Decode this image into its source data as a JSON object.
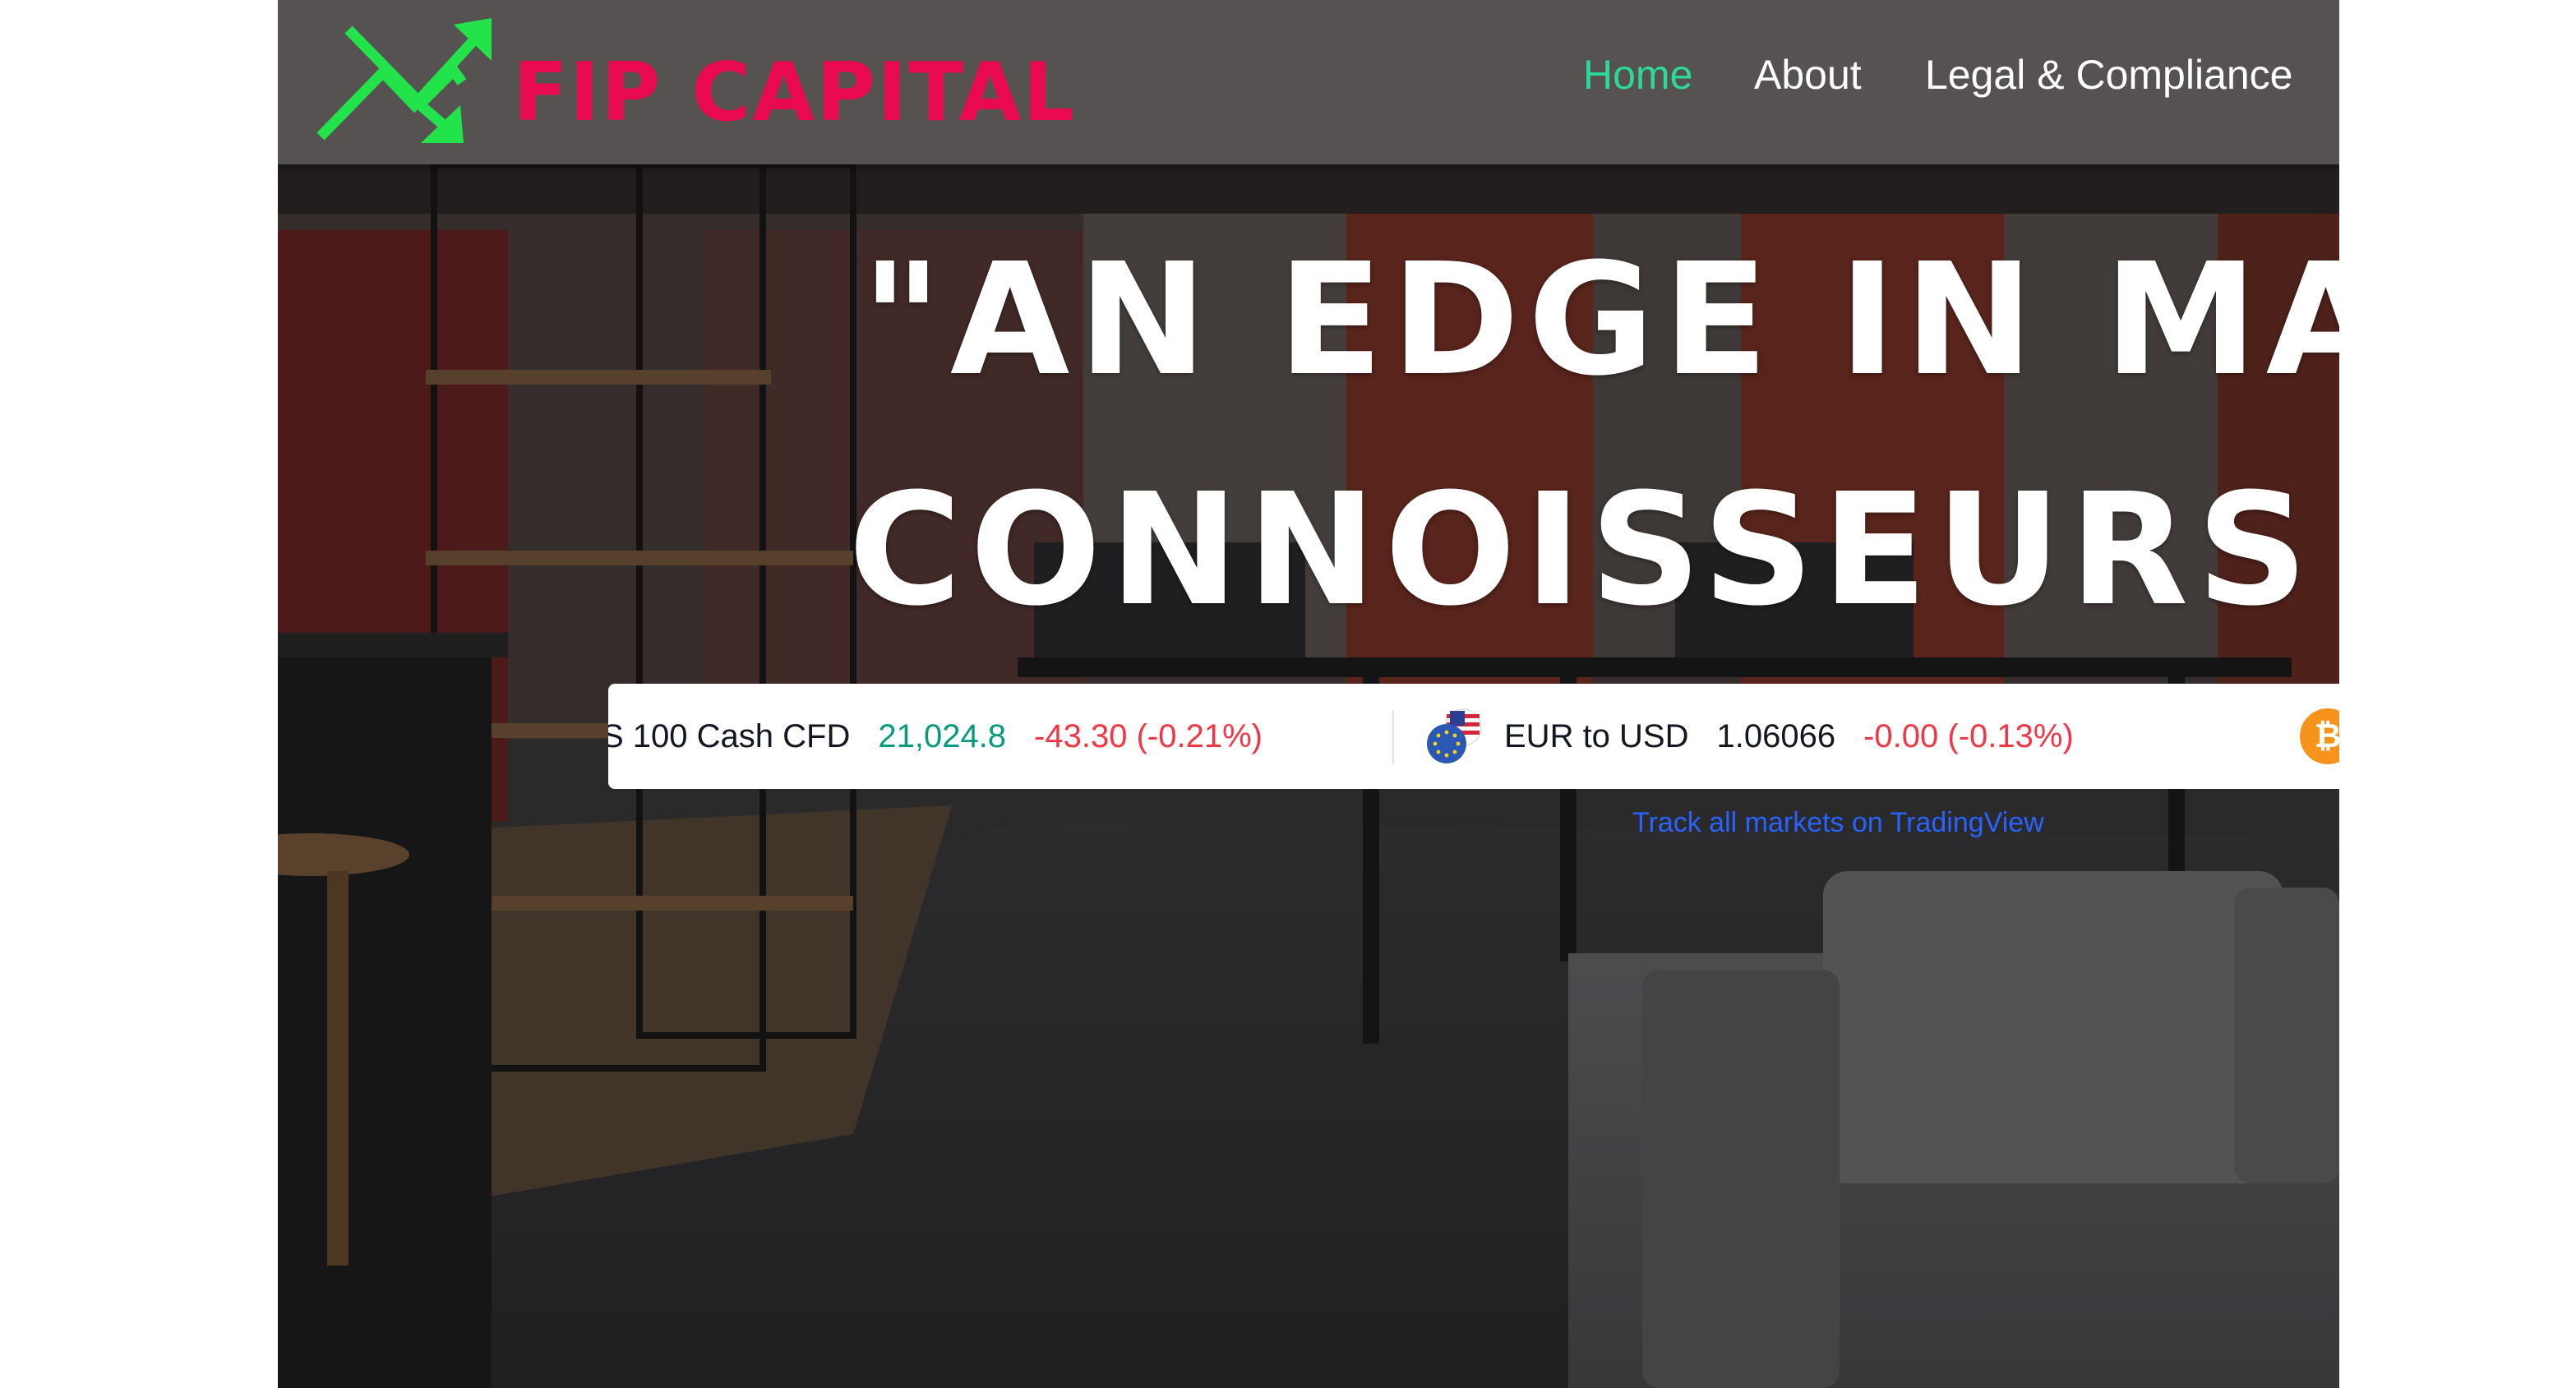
{
  "header": {
    "logo_text": "FIP CAPITAL",
    "nav": [
      {
        "label": "Home",
        "active": true
      },
      {
        "label": "About",
        "active": false
      },
      {
        "label": "Legal & Compliance",
        "active": false
      }
    ]
  },
  "hero": {
    "headline_line1": "\"AN EDGE IN MA",
    "headline_line2": "CONNOISSEURS"
  },
  "ticker": {
    "items": [
      {
        "symbol": "S 100 Cash CFD",
        "price": "21,024.8",
        "change": "-43.30 (-0.21%)"
      },
      {
        "symbol": "EUR to USD",
        "price": "1.06066",
        "change": "-0.00 (-0.13%)"
      }
    ],
    "btc_glyph": "₿",
    "track_link": "Track all markets on TradingView"
  },
  "colors": {
    "header_bg": "#555251",
    "nav_active": "#2ed89a",
    "logo_text": "#ea0a52",
    "logo_arrows": "#22e34a",
    "ticker_up": "#089981",
    "ticker_down": "#f23645",
    "link": "#2962ff"
  },
  "icons": [
    "logo-arrows-icon",
    "eur-usd-flag-icon",
    "bitcoin-icon"
  ]
}
